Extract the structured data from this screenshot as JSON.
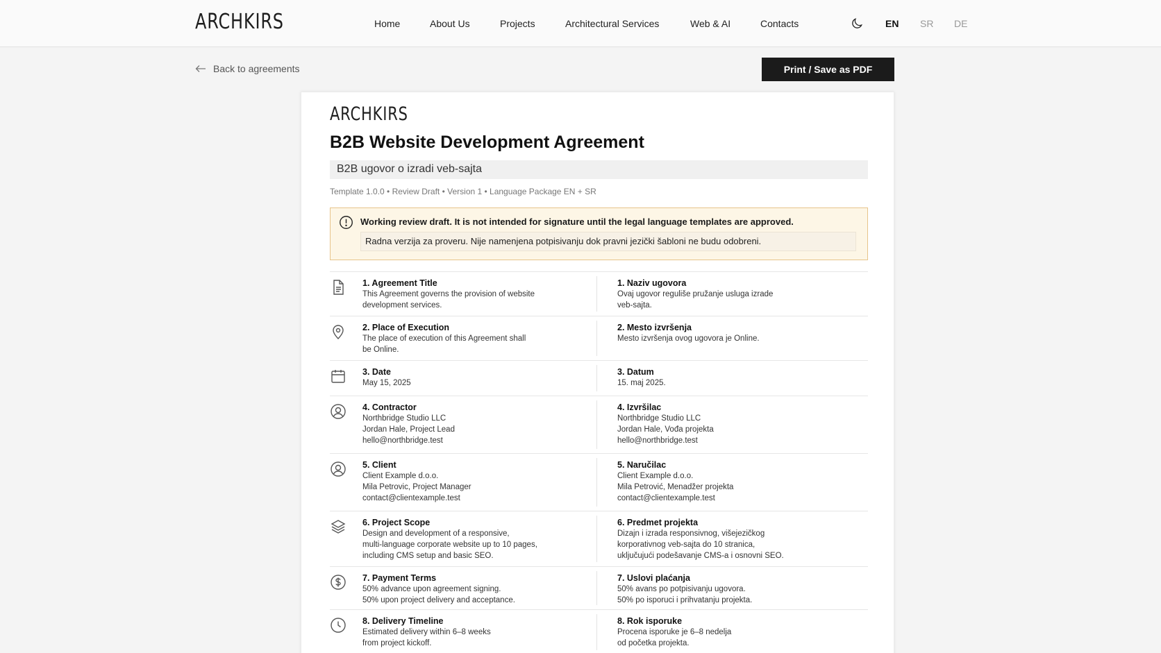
{
  "header": {
    "logo": "ARCHKIRS",
    "nav": [
      "Home",
      "About Us",
      "Projects",
      "Architectural Services",
      "Web & AI",
      "Contacts"
    ],
    "languages": [
      "EN",
      "SR",
      "DE"
    ],
    "active_language": "EN"
  },
  "toolbar": {
    "back_label": "Back to agreements",
    "print_label": "Print / Save as PDF"
  },
  "document": {
    "logo": "ARCHKIRS",
    "title": "B2B Website Development Agreement",
    "subtitle": "B2B ugovor o izradi veb-sajta",
    "meta": "Template 1.0.0 • Review Draft • Version 1 • Language Package EN + SR",
    "alert_en": "Working review draft. It is not intended for signature until the legal language templates are approved.",
    "alert_sr": "Radna verzija za proveru. Nije namenjena potpisivanju dok pravni jezički šabloni ne budu odobreni.",
    "sections": [
      {
        "icon": "document-icon",
        "en_title": "1. Agreement Title",
        "en_text": "This Agreement governs the provision of website\ndevelopment services.",
        "sr_title": "1. Naziv ugovora",
        "sr_text": "Ovaj ugovor reguliše pružanje usluga izrade\nveb-sajta."
      },
      {
        "icon": "location-pin-icon",
        "en_title": "2. Place of Execution",
        "en_text": "The place of execution of this Agreement shall\nbe Online.",
        "sr_title": "2. Mesto izvršenja",
        "sr_text": "Mesto izvršenja ovog ugovora je Online."
      },
      {
        "icon": "calendar-icon",
        "en_title": "3. Date",
        "en_text": "May 15, 2025",
        "sr_title": "3. Datum",
        "sr_text": "15. maj 2025."
      },
      {
        "icon": "user-circle-icon",
        "en_title": "4. Contractor",
        "en_text": "Northbridge Studio LLC\nJordan Hale, Project Lead\nhello@northbridge.test",
        "sr_title": "4. Izvršilac",
        "sr_text": "Northbridge Studio LLC\nJordan Hale, Vođa projekta\nhello@northbridge.test"
      },
      {
        "icon": "user-circle-icon",
        "en_title": "5. Client",
        "en_text": "Client Example d.o.o.\nMila Petrovic, Project Manager\ncontact@clientexample.test",
        "sr_title": "5. Naručilac",
        "sr_text": "Client Example d.o.o.\nMila Petrović, Menadžer projekta\ncontact@clientexample.test"
      },
      {
        "icon": "layers-icon",
        "en_title": "6. Project Scope",
        "en_text": "Design and development of a responsive,\nmulti-language corporate website up to 10 pages,\nincluding CMS setup and basic SEO.",
        "sr_title": "6. Predmet projekta",
        "sr_text": "Dizajn i izrada responsivnog, višejezičkog\nkorporativnog veb-sajta do 10 stranica,\nuključujući podešavanje CMS-a i osnovni SEO."
      },
      {
        "icon": "dollar-circle-icon",
        "en_title": "7. Payment Terms",
        "en_text": "50% advance upon agreement signing.\n50% upon project delivery and acceptance.",
        "sr_title": "7. Uslovi plaćanja",
        "sr_text": "50% avans po potpisivanju ugovora.\n50% po isporuci i prihvatanju projekta."
      },
      {
        "icon": "clock-icon",
        "en_title": "8. Delivery Timeline",
        "en_text": "Estimated delivery within 6–8 weeks\nfrom project kickoff.",
        "sr_title": "8. Rok isporuke",
        "sr_text": "Procena isporuke je 6–8 nedelja\nod početka projekta."
      }
    ]
  }
}
